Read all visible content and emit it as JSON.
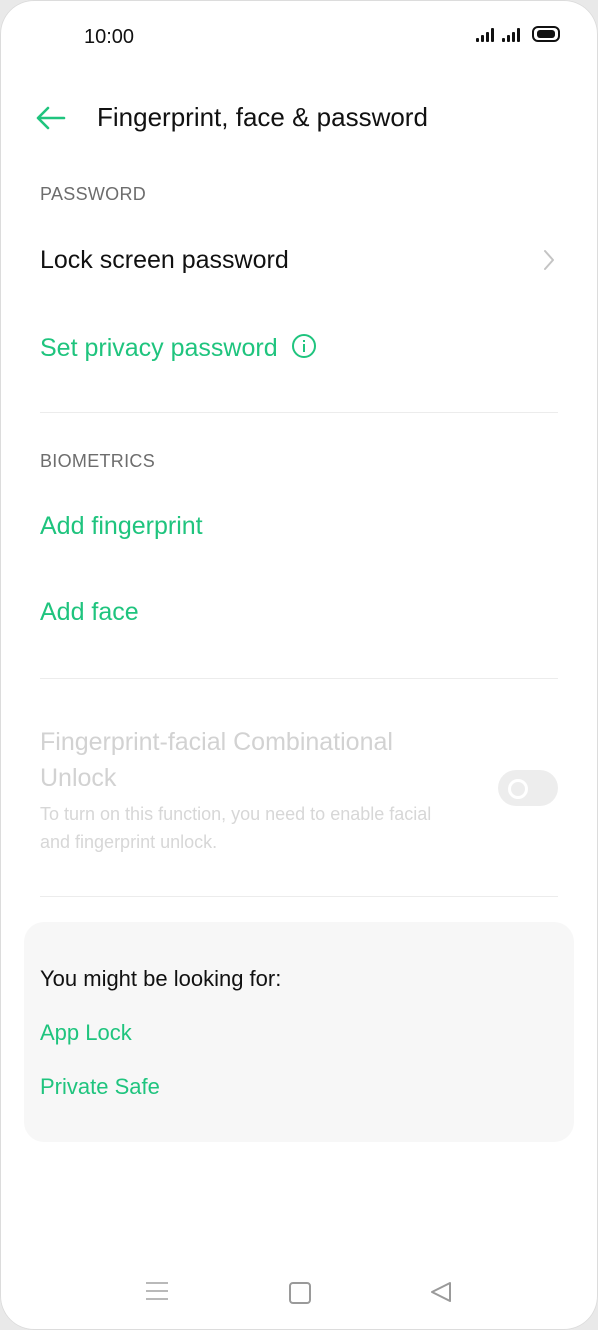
{
  "status_bar": {
    "time": "10:00"
  },
  "header": {
    "title": "Fingerprint, face & password"
  },
  "password_section": {
    "label": "PASSWORD",
    "lock_screen": "Lock screen password",
    "privacy": "Set privacy password"
  },
  "biometrics_section": {
    "label": "BIOMETRICS",
    "add_fingerprint": "Add fingerprint",
    "add_face": "Add face"
  },
  "combo": {
    "title": "Fingerprint-facial Combinational Unlock",
    "subtitle": "To turn on this function, you need to enable facial and fingerprint unlock."
  },
  "suggestions": {
    "title": "You might be looking for:",
    "items": [
      "App Lock",
      "Private Safe"
    ]
  },
  "colors": {
    "accent": "#1fc47e",
    "text": "#111111",
    "muted": "#6d6d6d",
    "disabled": "#d2d2d2"
  }
}
